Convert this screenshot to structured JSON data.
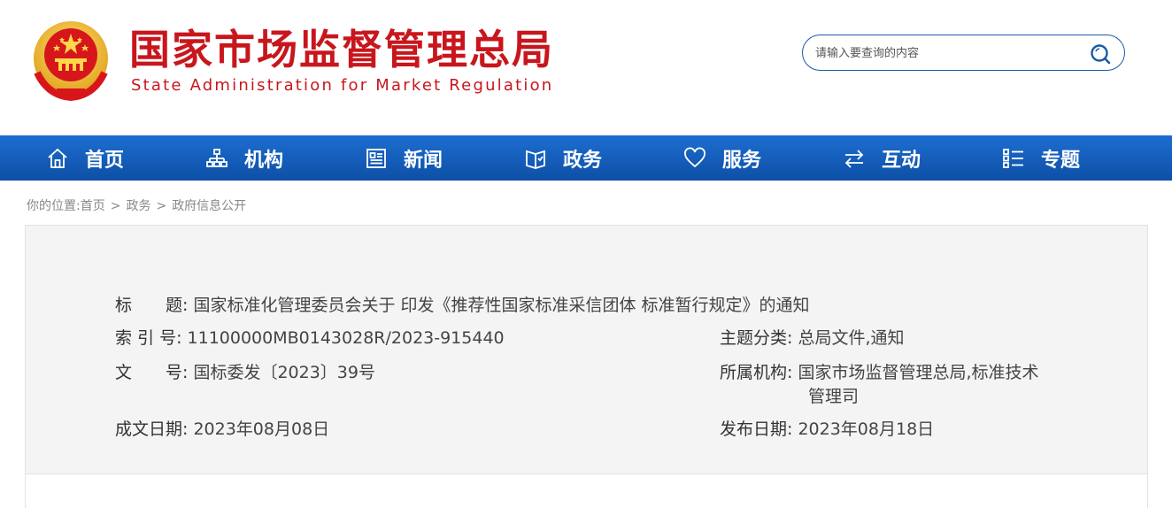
{
  "header": {
    "title_cn": "国家市场监督管理总局",
    "title_en": "State Administration for Market Regulation",
    "search_placeholder": "请输入要查询的内容"
  },
  "nav": {
    "items": [
      {
        "label": "首页",
        "icon": "home-icon"
      },
      {
        "label": "机构",
        "icon": "org-chart-icon"
      },
      {
        "label": "新闻",
        "icon": "newspaper-icon"
      },
      {
        "label": "政务",
        "icon": "book-icon"
      },
      {
        "label": "服务",
        "icon": "heart-icon"
      },
      {
        "label": "互动",
        "icon": "exchange-arrows-icon"
      },
      {
        "label": "专题",
        "icon": "list-icon"
      }
    ]
  },
  "breadcrumb": {
    "prefix": "你的位置:",
    "items": [
      "首页",
      "政务",
      "政府信息公开"
    ],
    "separator": ">"
  },
  "info": {
    "title_label": "标　　题:",
    "title_value": "国家标准化管理委员会关于 印发《推荐性国家标准采信团体 标准暂行规定》的通知",
    "index_label": "索 引 号:",
    "index_value": "11100000MB0143028R/2023-915440",
    "category_label": "主题分类:",
    "category_value": "总局文件,通知",
    "docno_label": "文　　号:",
    "docno_value": "国标委发〔2023〕39号",
    "org_label": "所属机构:",
    "org_value_line1": "国家市场监督管理总局,标准技术",
    "org_value_line2": "管理司",
    "created_label": "成文日期:",
    "created_value": "2023年08月08日",
    "published_label": "发布日期:",
    "published_value": "2023年08月18日"
  },
  "colors": {
    "brand_red": "#c8161d",
    "nav_blue": "#0d4fa6",
    "panel_bg": "#f4f4f4"
  }
}
